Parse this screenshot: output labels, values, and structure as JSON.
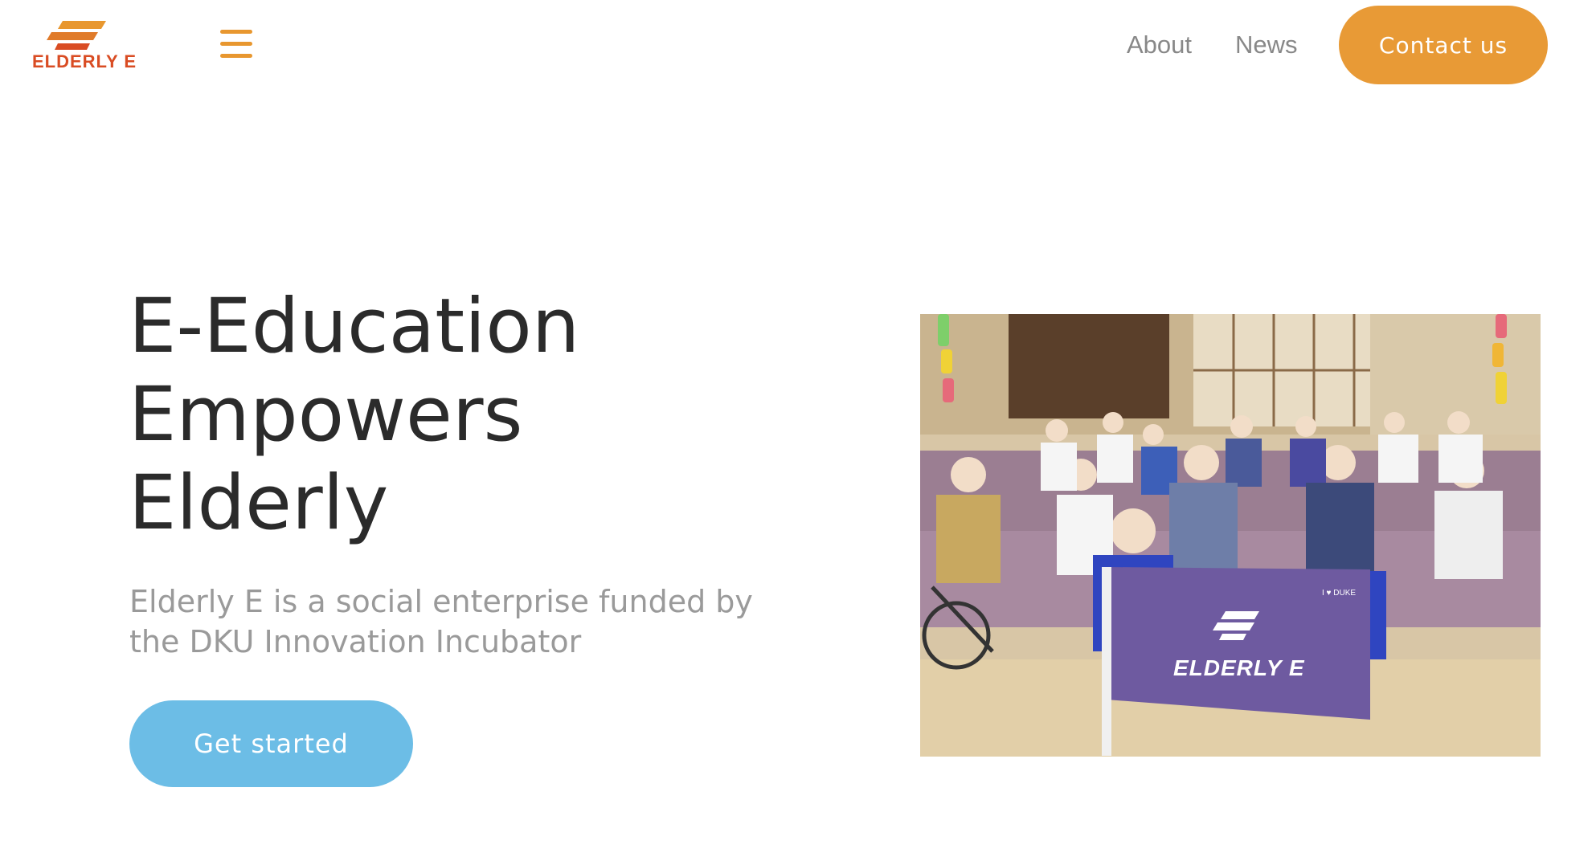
{
  "header": {
    "logo_text": "ELDERLY E",
    "menu_icon": "hamburger-menu-icon",
    "nav": {
      "about_label": "About",
      "news_label": "News",
      "contact_label": "Contact us"
    }
  },
  "hero": {
    "title_lines": [
      "E-Education",
      "Empowers",
      "Elderly"
    ],
    "subtitle_lines": [
      "Elderly E is a social enterprise funded by",
      "the DKU Innovation Incubator"
    ],
    "cta_label": "Get started"
  },
  "photo": {
    "flag_text": "ELDERLY E",
    "shirt_badge": "I ♥ DUKE"
  },
  "colors": {
    "brand_orange": "#e89a36",
    "logo_red": "#d94c23",
    "cta_blue": "#6cbde6",
    "title_text": "#2b2b2b",
    "subtitle_text": "#9a9a9a",
    "nav_text": "#888888",
    "flag_purple": "#6e5aa0"
  }
}
